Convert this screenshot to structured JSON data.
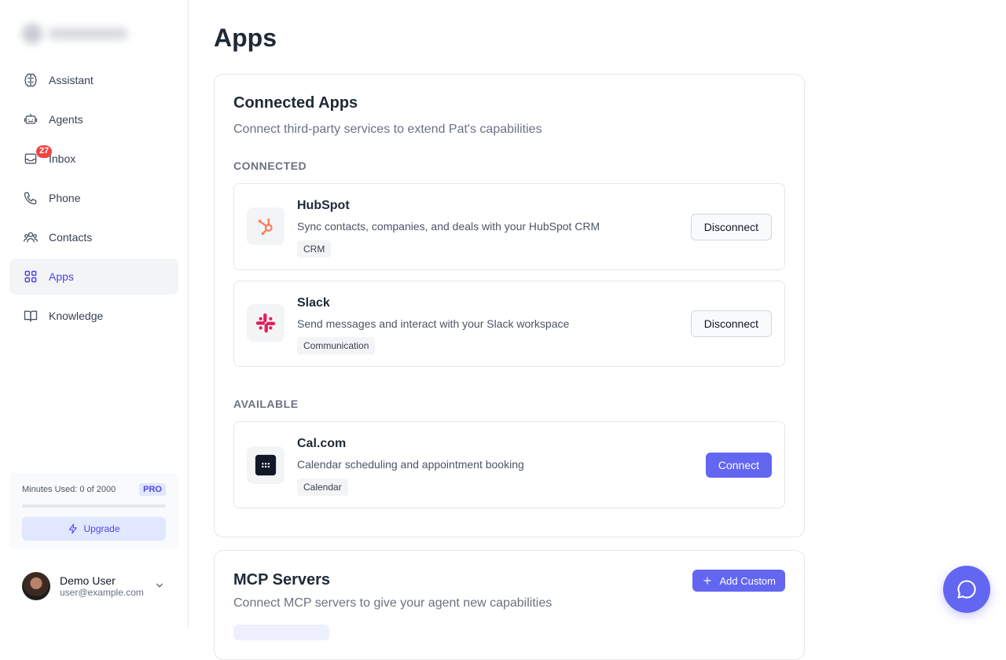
{
  "sidebar": {
    "items": [
      {
        "label": "Assistant",
        "icon": "brain-icon"
      },
      {
        "label": "Agents",
        "icon": "robot-icon"
      },
      {
        "label": "Inbox",
        "icon": "inbox-icon",
        "badge": "27"
      },
      {
        "label": "Phone",
        "icon": "phone-icon"
      },
      {
        "label": "Contacts",
        "icon": "users-icon"
      },
      {
        "label": "Apps",
        "icon": "grid-icon",
        "active": true
      },
      {
        "label": "Knowledge",
        "icon": "book-icon"
      }
    ],
    "usage": {
      "text": "Minutes Used: 0 of 2000",
      "plan_badge": "PRO",
      "used": 0,
      "total": 2000,
      "upgrade_label": "Upgrade"
    },
    "user": {
      "name": "Demo User",
      "email": "user@example.com"
    }
  },
  "main": {
    "title": "Apps",
    "connected_apps": {
      "title": "Connected Apps",
      "subtitle": "Connect third-party services to extend Pat's capabilities",
      "connected_label": "CONNECTED",
      "available_label": "AVAILABLE",
      "connected": [
        {
          "name": "HubSpot",
          "description": "Sync contacts, companies, and deals with your HubSpot CRM",
          "tag": "CRM",
          "action": "Disconnect",
          "icon": "hubspot-icon"
        },
        {
          "name": "Slack",
          "description": "Send messages and interact with your Slack workspace",
          "tag": "Communication",
          "action": "Disconnect",
          "icon": "slack-icon"
        }
      ],
      "available": [
        {
          "name": "Cal.com",
          "description": "Calendar scheduling and appointment booking",
          "tag": "Calendar",
          "action": "Connect",
          "icon": "calcom-icon"
        }
      ]
    },
    "mcp_servers": {
      "title": "MCP Servers",
      "subtitle": "Connect MCP servers to give your agent new capabilities",
      "add_label": "Add Custom"
    }
  },
  "colors": {
    "accent": "#6366f1",
    "badge": "#ef4444",
    "hubspot": "#ff7a59",
    "slack": "#e01e5a"
  }
}
